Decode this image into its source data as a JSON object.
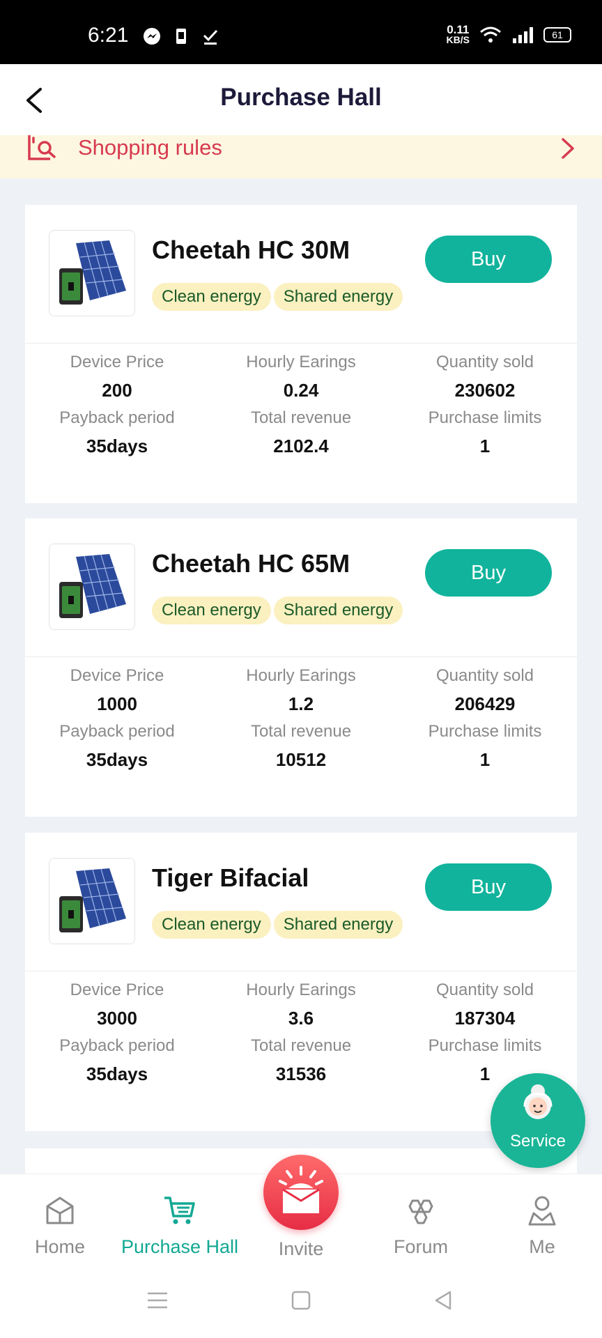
{
  "status_bar": {
    "time": "6:21",
    "net_speed_value": "0.11",
    "net_speed_unit": "KB/S",
    "battery": "61"
  },
  "header": {
    "title": "Purchase Hall"
  },
  "rules": {
    "label": "Shopping rules"
  },
  "labels": {
    "device_price": "Device Price",
    "hourly_earnings": "Hourly Earings",
    "quantity_sold": "Quantity sold",
    "payback_period": "Payback period",
    "total_revenue": "Total revenue",
    "purchase_limits": "Purchase limits",
    "buy": "Buy"
  },
  "products": [
    {
      "name": "Cheetah HC 30M",
      "tags": [
        "Clean energy",
        "Shared energy"
      ],
      "device_price": "200",
      "hourly_earnings": "0.24",
      "quantity_sold": "230602",
      "payback_period": "35days",
      "total_revenue": "2102.4",
      "purchase_limits": "1"
    },
    {
      "name": "Cheetah HC 65M",
      "tags": [
        "Clean energy",
        "Shared energy"
      ],
      "device_price": "1000",
      "hourly_earnings": "1.2",
      "quantity_sold": "206429",
      "payback_period": "35days",
      "total_revenue": "10512",
      "purchase_limits": "1"
    },
    {
      "name": "Tiger Bifacial",
      "tags": [
        "Clean energy",
        "Shared energy"
      ],
      "device_price": "3000",
      "hourly_earnings": "3.6",
      "quantity_sold": "187304",
      "payback_period": "35days",
      "total_revenue": "31536",
      "purchase_limits": "1"
    }
  ],
  "service": {
    "label": "Service"
  },
  "tabbar": {
    "items": [
      {
        "label": "Home",
        "icon": "home-icon"
      },
      {
        "label": "Purchase Hall",
        "icon": "cart-icon"
      },
      {
        "label": "Invite",
        "icon": "gift-icon"
      },
      {
        "label": "Forum",
        "icon": "forum-icon"
      },
      {
        "label": "Me",
        "icon": "person-icon"
      }
    ],
    "active": "Purchase Hall"
  },
  "colors": {
    "accent": "#11b39c",
    "rules_text": "#d73a4f",
    "tag_bg": "#fbf0c0",
    "invite": "#e62d45"
  }
}
